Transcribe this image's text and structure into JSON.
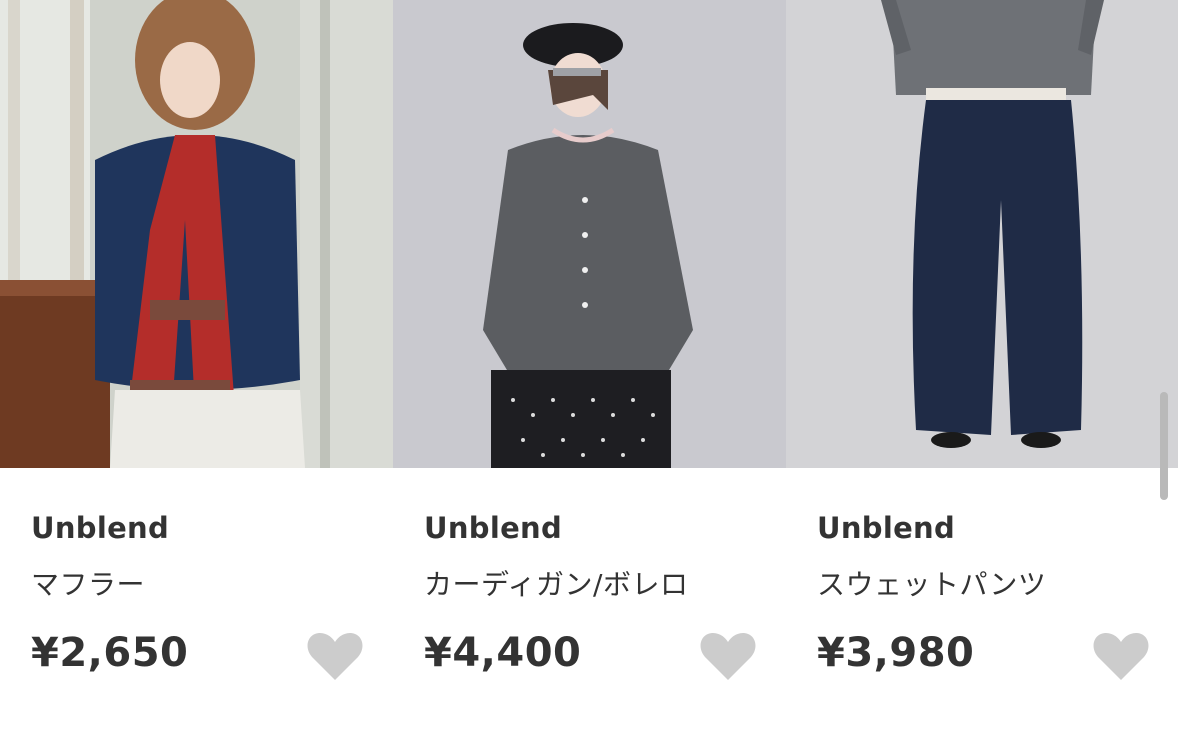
{
  "products": [
    {
      "image_icon": "model-photo-scarf-icon",
      "brand": "Unblend",
      "name": "マフラー",
      "price": "¥2,650",
      "favorite_icon": "heart-icon"
    },
    {
      "image_icon": "model-photo-cardigan-icon",
      "brand": "Unblend",
      "name": "カーディガン/ボレロ",
      "price": "¥4,400",
      "favorite_icon": "heart-icon"
    },
    {
      "image_icon": "model-photo-pants-icon",
      "brand": "Unblend",
      "name": "スウェットパンツ",
      "price": "¥3,980",
      "favorite_icon": "heart-icon"
    }
  ],
  "colors": {
    "text": "#333333",
    "heart": "#cccccc",
    "scrollbar": "#b9b9b9"
  }
}
